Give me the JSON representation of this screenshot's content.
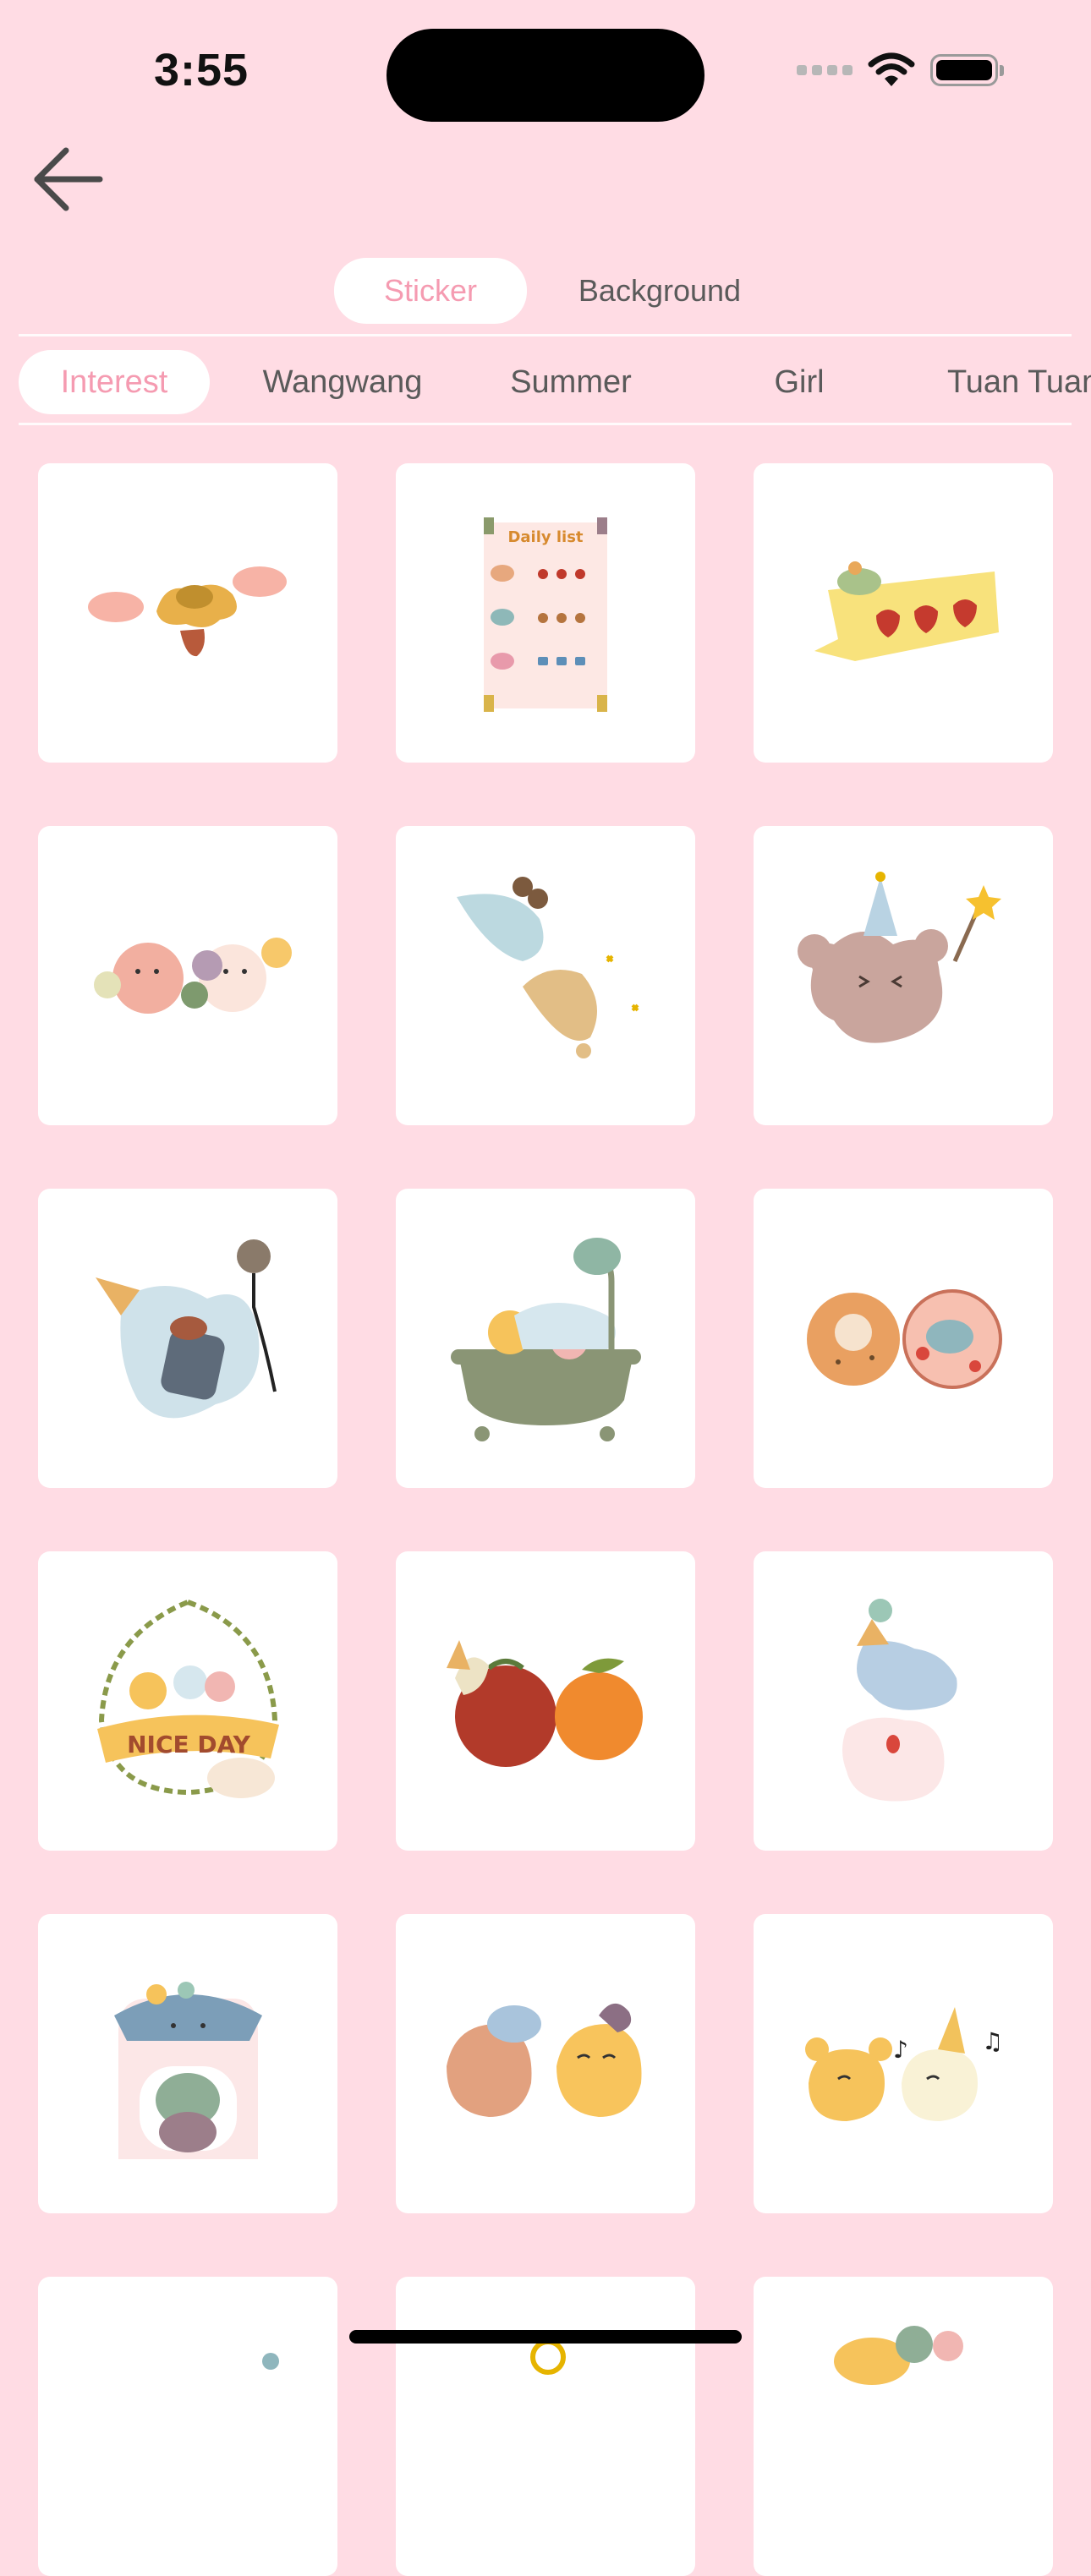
{
  "status_bar": {
    "time": "3:55"
  },
  "nav": {
    "back_icon": "arrow-left-icon"
  },
  "mode_tabs": [
    {
      "label": "Sticker",
      "active": true
    },
    {
      "label": "Background",
      "active": false
    }
  ],
  "categories": [
    {
      "label": "Interest",
      "active": true
    },
    {
      "label": "Wangwang",
      "active": false
    },
    {
      "label": "Summer",
      "active": false
    },
    {
      "label": "Girl",
      "active": false
    },
    {
      "label": "Tuan Tuan",
      "active": false
    }
  ],
  "stickers": [
    {
      "id": "s1",
      "icon": "flower-sticker"
    },
    {
      "id": "s2",
      "icon": "daily-list-sticker",
      "caption": "Daily list"
    },
    {
      "id": "s3",
      "icon": "strawberry-banner-sticker"
    },
    {
      "id": "s4",
      "icon": "friends-group-sticker"
    },
    {
      "id": "s5",
      "icon": "bears-jumping-sticker"
    },
    {
      "id": "s6",
      "icon": "party-bear-sticker"
    },
    {
      "id": "s7",
      "icon": "singing-unicorn-sticker"
    },
    {
      "id": "s8",
      "icon": "bathtub-sticker"
    },
    {
      "id": "s9",
      "icon": "cookies-sticker"
    },
    {
      "id": "s10",
      "icon": "nice-day-wreath-sticker",
      "caption": "NICE DAY"
    },
    {
      "id": "s11",
      "icon": "fruits-sticker"
    },
    {
      "id": "s12",
      "icon": "stacked-friends-sticker"
    },
    {
      "id": "s13",
      "icon": "gacha-machine-sticker"
    },
    {
      "id": "s14",
      "icon": "hugging-friends-sticker"
    },
    {
      "id": "s15",
      "icon": "music-friends-sticker"
    }
  ],
  "colors": {
    "background": "#FFDCE4",
    "accent": "#F59BB1",
    "card": "#FFFFFF"
  }
}
